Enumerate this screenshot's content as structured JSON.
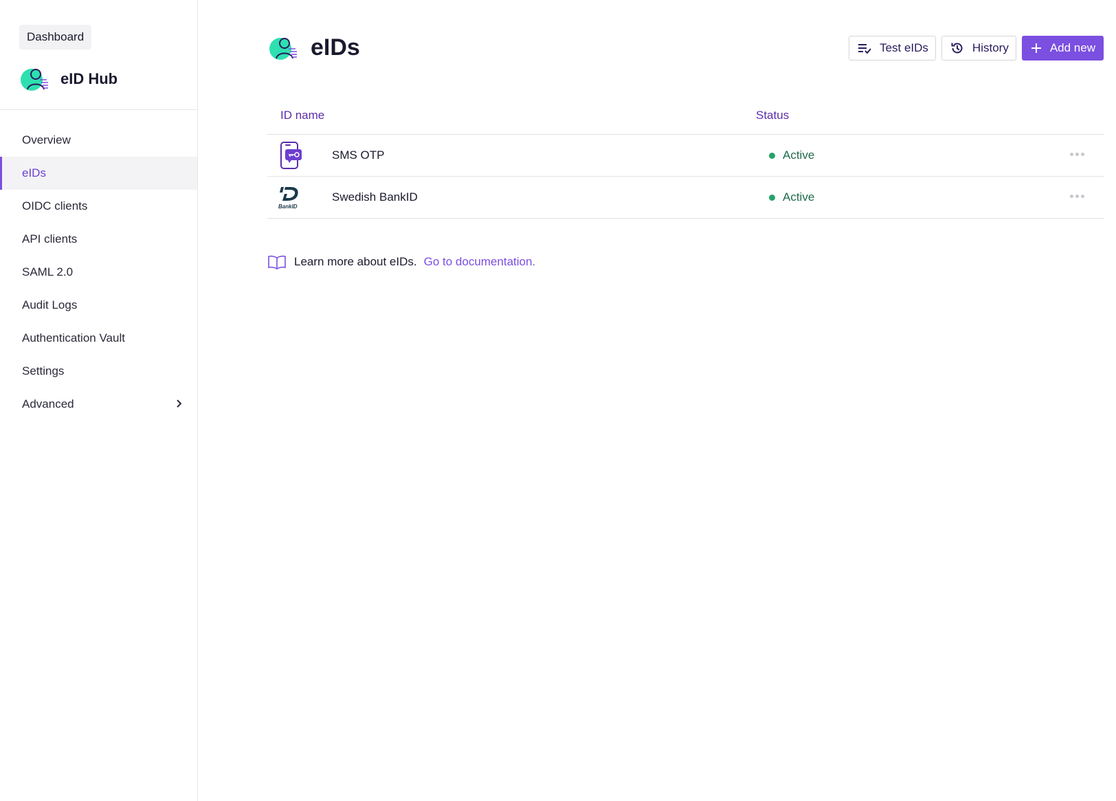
{
  "sidebar": {
    "dashboard_label": "Dashboard",
    "brand_name": "eID Hub",
    "items": [
      {
        "label": "Overview"
      },
      {
        "label": "eIDs"
      },
      {
        "label": "OIDC clients"
      },
      {
        "label": "API clients"
      },
      {
        "label": "SAML 2.0"
      },
      {
        "label": "Audit Logs"
      },
      {
        "label": "Authentication Vault"
      },
      {
        "label": "Settings"
      },
      {
        "label": "Advanced"
      }
    ],
    "active_item": "eIDs"
  },
  "header": {
    "title": "eIDs",
    "test_label": "Test eIDs",
    "history_label": "History",
    "add_label": "Add new"
  },
  "table": {
    "columns": [
      "ID name",
      "Status"
    ],
    "rows": [
      {
        "name": "SMS OTP",
        "status": "Active",
        "icon": "sms-otp-icon"
      },
      {
        "name": "Swedish BankID",
        "status": "Active",
        "icon": "bankid-icon"
      }
    ]
  },
  "footer": {
    "learn_text": "Learn more about eIDs.",
    "doc_link": "Go to documentation."
  },
  "colors": {
    "accent": "#7b4fe0",
    "status_active": "#24a36a",
    "brand_teal": "#2ee0b0"
  }
}
